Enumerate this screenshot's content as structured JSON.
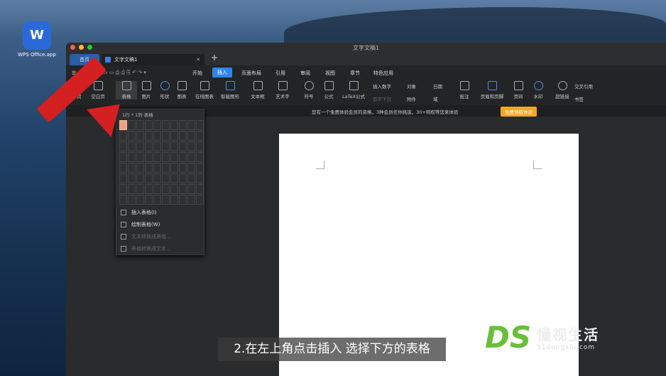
{
  "desktop": {
    "app_icon_label": "WPS Office.app",
    "app_icon_glyph": "W"
  },
  "window": {
    "title": "文字文稿1",
    "traffic_colors": [
      "#fe5f57",
      "#febc2e",
      "#28c840"
    ]
  },
  "tabs": {
    "home": "首页",
    "doc": "文字文稿1",
    "close": "✕",
    "new": "+"
  },
  "menu": {
    "file": "☰ 文件",
    "items": [
      "开始",
      "插入",
      "页面布局",
      "引用",
      "审阅",
      "视图",
      "章节",
      "特色应用"
    ],
    "active": "插入"
  },
  "ribbon": {
    "big": [
      "分页",
      "空白页",
      "表格",
      "图片",
      "形状",
      "图表",
      "在线图表",
      "智能图形",
      "文本框",
      "艺术字",
      "符号",
      "公式",
      "LaTeX公式"
    ],
    "small_top": [
      "插入数字",
      "对象",
      "日期"
    ],
    "small_bottom": [
      "首字下沉",
      "附件",
      "域"
    ],
    "big2": [
      "批注",
      "页眉和页脚",
      "页码",
      "水印",
      "超链接"
    ],
    "small2": [
      "交叉引用",
      "书签"
    ]
  },
  "promo": {
    "text": "您有一个免费体验会员的资格，3种会员任你挑选，30+特权等您来体验",
    "button": "免费领取体验"
  },
  "table_dropdown": {
    "header": "1行 * 1列 表格",
    "rows": 8,
    "cols": 10,
    "selected": "1x1",
    "items": [
      {
        "label": "插入表格(I)",
        "enabled": true
      },
      {
        "label": "绘制表格(W)",
        "enabled": true
      },
      {
        "label": "文本转换成表格...",
        "enabled": false
      },
      {
        "label": "表格转换成文本...",
        "enabled": false
      }
    ]
  },
  "subtitle": "2.在左上角点击插入 选择下方的表格",
  "watermark": {
    "logo": "DS",
    "name": "懂视生活",
    "url": "51dongshi.com"
  }
}
